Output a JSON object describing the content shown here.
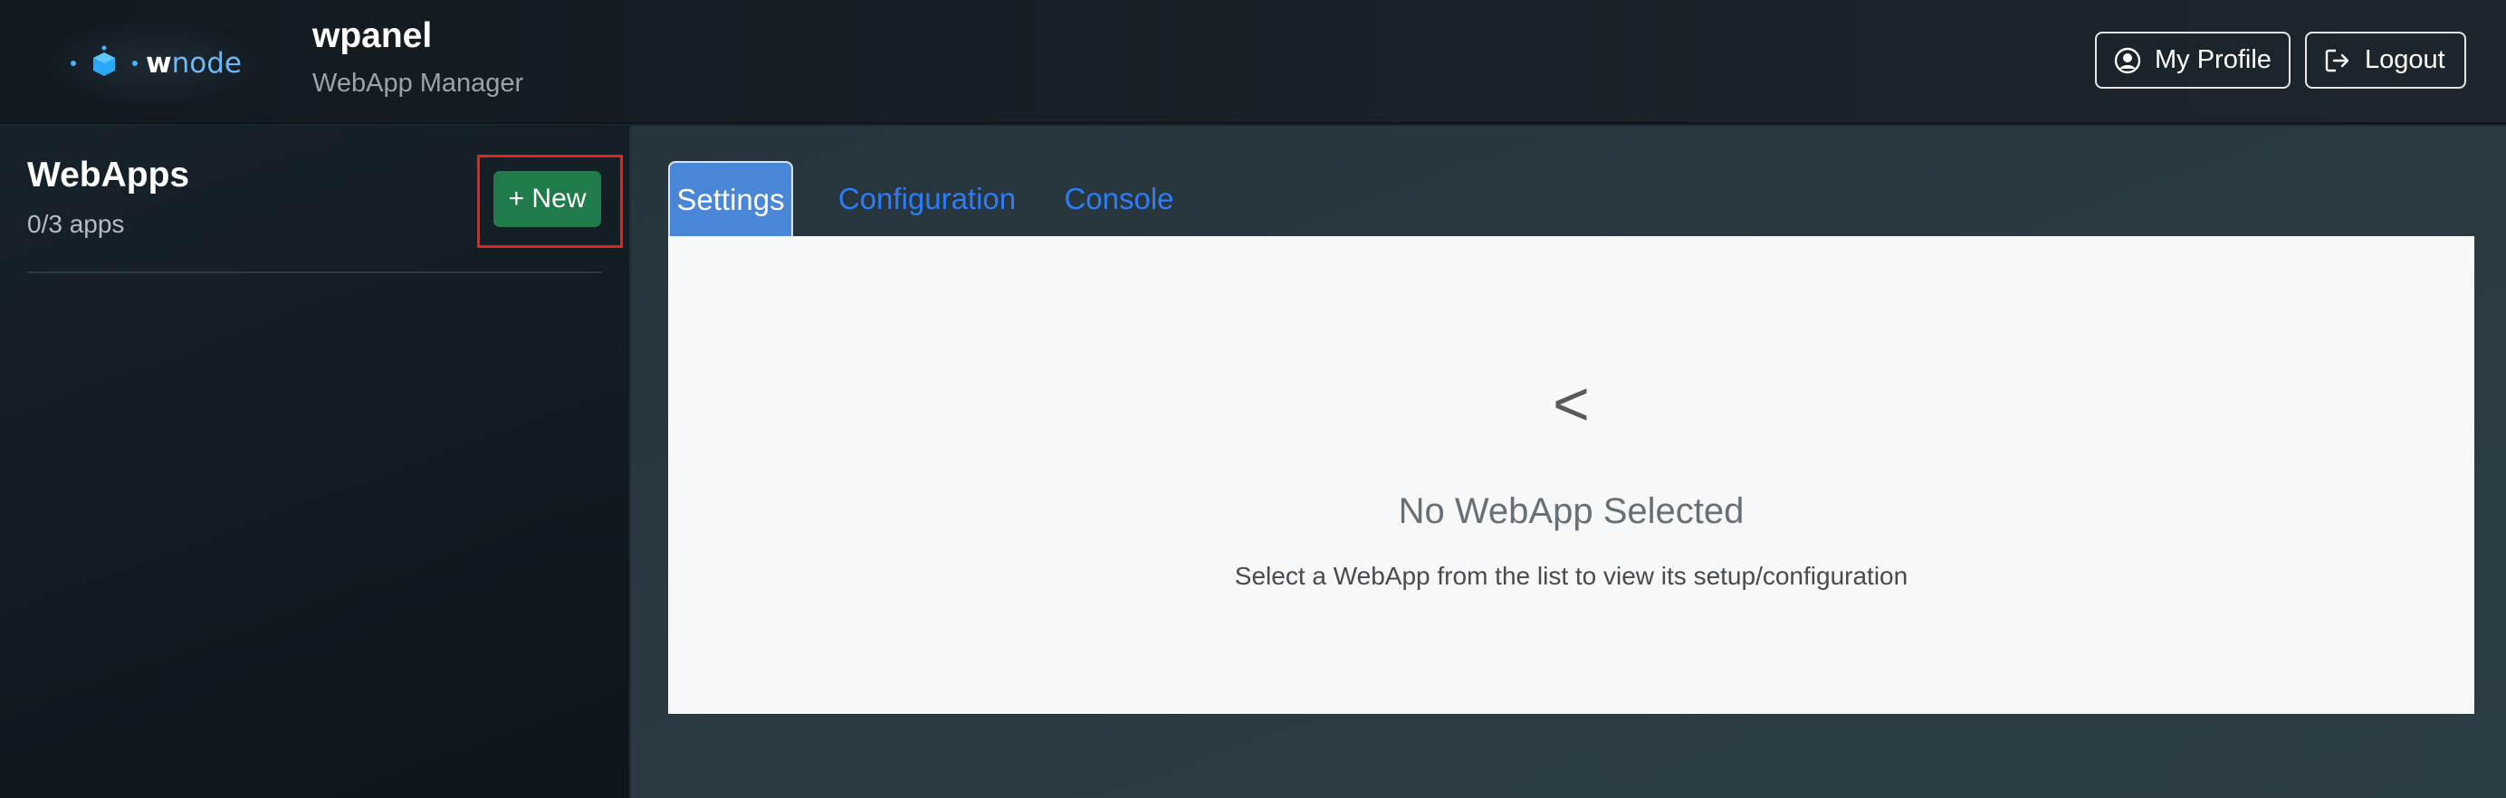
{
  "header": {
    "logo": {
      "text_w": "w",
      "text_rest": "node"
    },
    "title": "wpanel",
    "subtitle": "WebApp Manager",
    "profile_label": "My Profile",
    "logout_label": "Logout",
    "icons": {
      "profile": "user-circle-icon",
      "logout": "logout-icon"
    }
  },
  "sidebar": {
    "title": "WebApps",
    "count": "0/3 apps",
    "new_label": "+ New"
  },
  "tabs": [
    {
      "label": "Settings",
      "active": true
    },
    {
      "label": "Configuration",
      "active": false
    },
    {
      "label": "Console",
      "active": false
    }
  ],
  "empty_state": {
    "icon": "<",
    "title": "No WebApp Selected",
    "description": "Select a WebApp from the list to view its setup/configuration"
  },
  "colors": {
    "accent_tab": "#4a86d8",
    "link": "#2e7cf6",
    "new_button": "#1f7b4a",
    "highlight": "#e02424"
  }
}
